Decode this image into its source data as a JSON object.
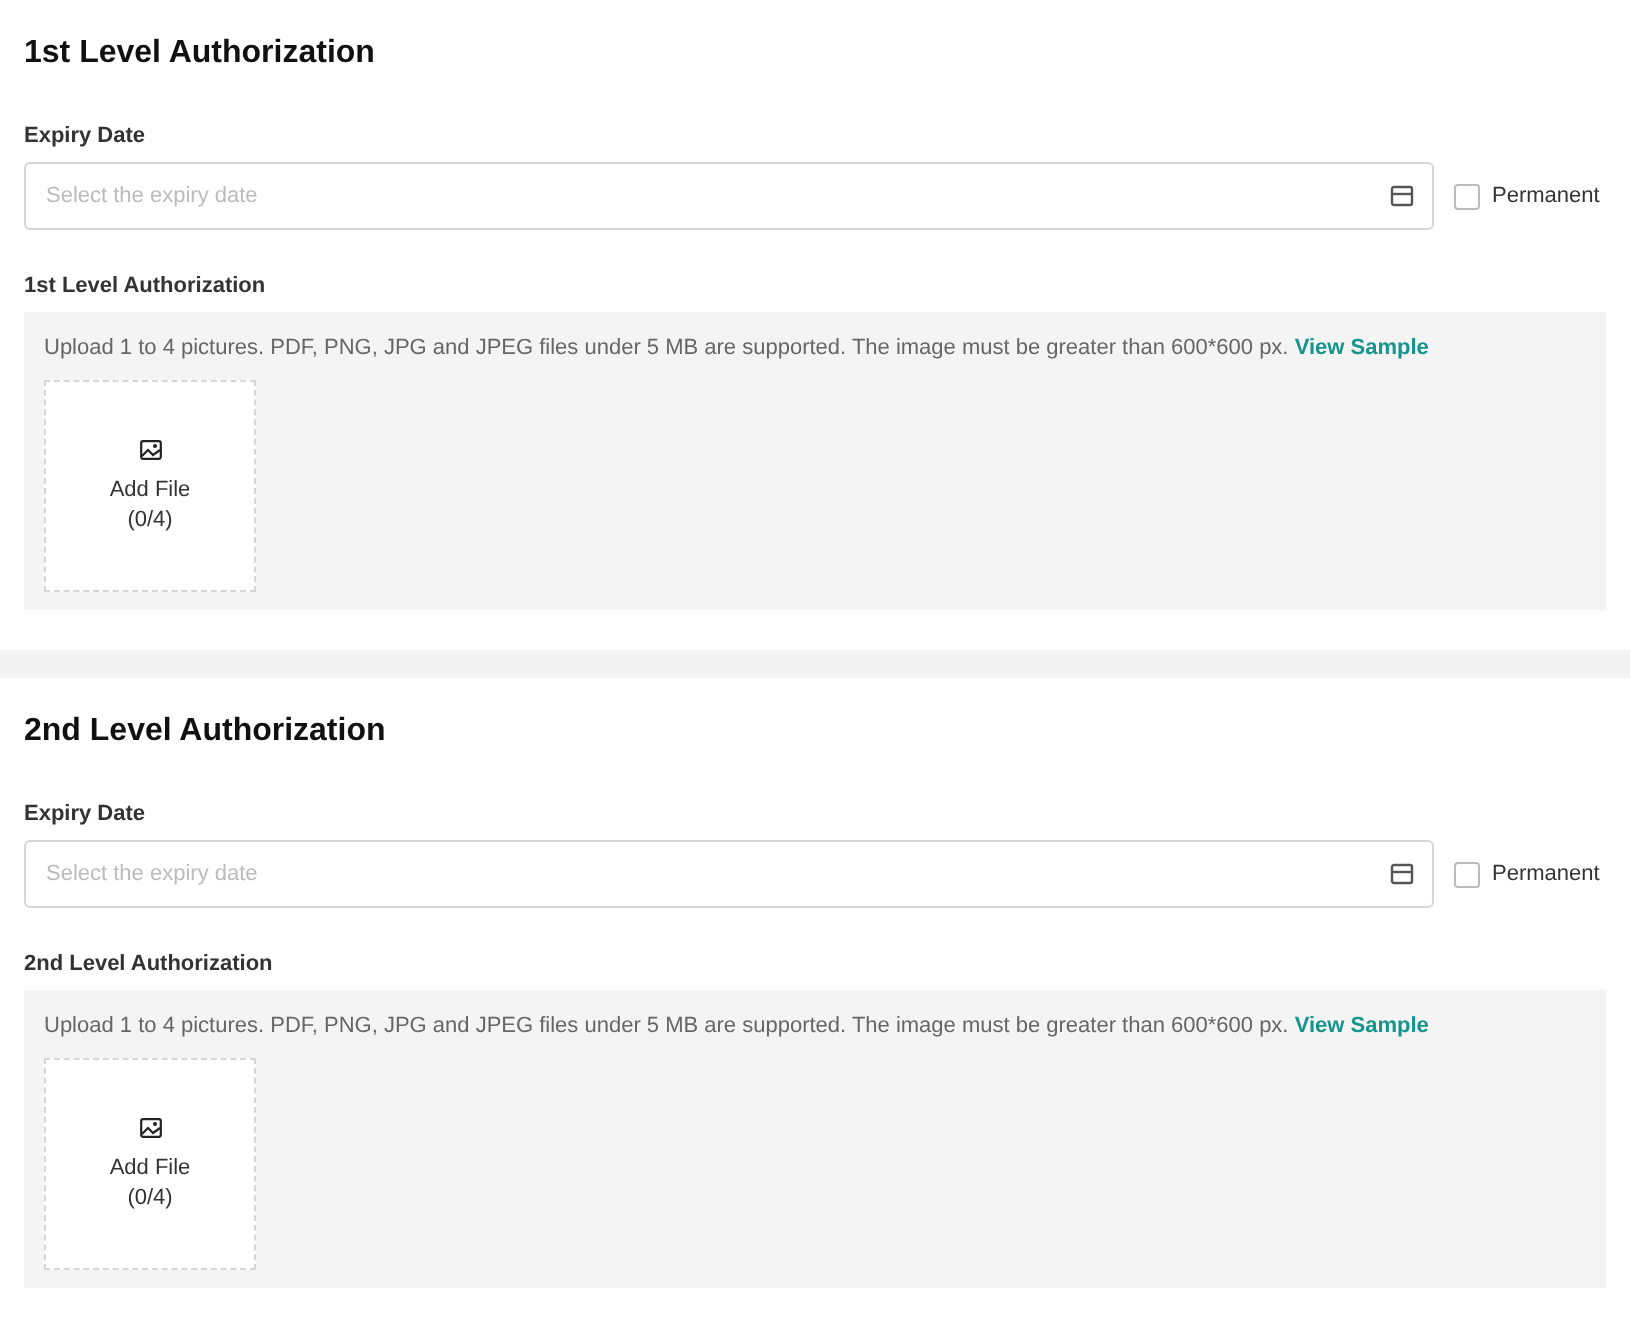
{
  "sections": [
    {
      "title": "1st Level Authorization",
      "expiry_label": "Expiry Date",
      "expiry_field": {
        "placeholder": "Select the expiry date"
      },
      "permanent": {
        "label": "Permanent",
        "checked": false
      },
      "upload_label": "1st Level Authorization",
      "upload_hint": "Upload 1 to 4 pictures. PDF, PNG, JPG and JPEG files under 5 MB are supported. The image must be greater than 600*600 px.",
      "sample_link": "View Sample",
      "add_file": {
        "label": "Add File",
        "count": "(0/4)"
      }
    },
    {
      "title": "2nd Level Authorization",
      "expiry_label": "Expiry Date",
      "expiry_field": {
        "placeholder": "Select the expiry date"
      },
      "permanent": {
        "label": "Permanent",
        "checked": false
      },
      "upload_label": "2nd Level Authorization",
      "upload_hint": "Upload 1 to 4 pictures. PDF, PNG, JPG and JPEG files under 5 MB are supported. The image must be greater than 600*600 px.",
      "sample_link": "View Sample",
      "add_file": {
        "label": "Add File",
        "count": "(0/4)"
      }
    }
  ]
}
